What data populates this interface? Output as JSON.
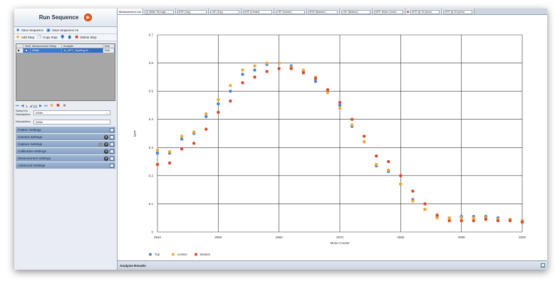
{
  "left_panel": {
    "run_title": "Run Sequence",
    "toolbar1": {
      "save": "Save Sequence",
      "save_as": "Save Sequence As"
    },
    "toolbar2": {
      "add": "Add Step",
      "copy": "Copy Step",
      "delete": "Delete Step"
    },
    "grid": {
      "headers": [
        "Select",
        "Measurement Setup",
        "Analysis",
        "Edit"
      ],
      "row": {
        "measurement": "White",
        "analysis": "3x_MTF_Spatting &l...",
        "edit": "Edit"
      }
    },
    "nav": {
      "page": "1",
      "of": "of {1}"
    },
    "select_for_label": "Select for Description:",
    "select_for_value": "White",
    "description_label": "Description:",
    "description_value": "White",
    "sections": [
      {
        "label": "Pattern Settings",
        "round_icons": []
      },
      {
        "label": "Camera Settings",
        "round_icons": [
          "black"
        ]
      },
      {
        "label": "Capture Settings",
        "round_icons": [
          "gray",
          "black"
        ]
      },
      {
        "label": "Calibration Settings",
        "round_icons": [
          "black"
        ]
      },
      {
        "label": "Measurement Settings",
        "round_icons": [
          "black"
        ]
      },
      {
        "label": "Advanced Settings",
        "round_icons": []
      }
    ]
  },
  "tabs": {
    "first": "Measurement List",
    "items": [
      {
        "label": "",
        "box": "0) White Through ..."
      },
      {
        "label": "",
        "box": "ESF (Top)"
      },
      {
        "label": "",
        "box": "LSF (Top)"
      },
      {
        "label": "",
        "box": "ESF (Center)"
      },
      {
        "label": "",
        "box": "LSF (Center)"
      },
      {
        "label": "",
        "box": "ESF (Bottom)"
      },
      {
        "label": "",
        "box": "LSF (Bottom)"
      },
      {
        "label": "",
        "box": "MTF, Motor Count..."
      },
      {
        "label": "",
        "box": "MTF @ 10 lp/mm"
      },
      {
        "label": "",
        "box": "MTF @ 20 lp/mm"
      }
    ]
  },
  "analysis_results": "Analysis Results",
  "chart_data": {
    "type": "scatter",
    "xlabel": "Motor Counts",
    "ylabel": "MTF",
    "xlim": [
      2940,
      3000
    ],
    "ylim": [
      0,
      0.7
    ],
    "x_ticks": [
      2940,
      2950,
      2960,
      2970,
      2980,
      2990,
      3000
    ],
    "y_ticks": [
      0,
      0.1,
      0.2,
      0.3,
      0.4,
      0.5,
      0.6,
      0.7
    ],
    "grid": true,
    "legend_position": "bottom-left",
    "series": [
      {
        "name": "Top",
        "color": "#4a7fd6",
        "x": [
          2940,
          2942,
          2944,
          2946,
          2948,
          2950,
          2952,
          2954,
          2956,
          2958,
          2960,
          2962,
          2964,
          2966,
          2968,
          2970,
          2972,
          2974,
          2976,
          2978,
          2980,
          2982,
          2984,
          2986,
          2988,
          2990,
          2992,
          2994,
          2996,
          2998,
          3000
        ],
        "y": [
          0.28,
          0.28,
          0.33,
          0.35,
          0.41,
          0.455,
          0.5,
          0.56,
          0.575,
          0.595,
          0.6,
          0.59,
          0.57,
          0.535,
          0.5,
          0.45,
          0.375,
          0.32,
          0.235,
          0.215,
          0.17,
          0.115,
          0.08,
          0.055,
          0.05,
          0.055,
          0.055,
          0.055,
          0.05,
          0.045,
          0.04
        ]
      },
      {
        "name": "Center",
        "color": "#f0a830",
        "x": [
          2940,
          2942,
          2944,
          2946,
          2948,
          2950,
          2952,
          2954,
          2956,
          2958,
          2960,
          2962,
          2964,
          2966,
          2968,
          2970,
          2972,
          2974,
          2976,
          2978,
          2980,
          2982,
          2984,
          2986,
          2988,
          2990,
          2992,
          2994,
          2996,
          2998,
          3000
        ],
        "y": [
          0.29,
          0.285,
          0.34,
          0.355,
          0.42,
          0.47,
          0.52,
          0.575,
          0.59,
          0.6,
          0.6,
          0.585,
          0.575,
          0.55,
          0.495,
          0.44,
          0.38,
          0.32,
          0.24,
          0.22,
          0.17,
          0.11,
          0.08,
          0.05,
          0.05,
          0.05,
          0.05,
          0.05,
          0.045,
          0.045,
          0.04
        ]
      },
      {
        "name": "Bottom",
        "color": "#d64a2a",
        "x": [
          2940,
          2942,
          2944,
          2946,
          2948,
          2950,
          2952,
          2954,
          2956,
          2958,
          2960,
          2962,
          2964,
          2966,
          2968,
          2970,
          2972,
          2974,
          2976,
          2978,
          2980,
          2982,
          2984,
          2986,
          2988,
          2990,
          2992,
          2994,
          2996,
          2998,
          3000
        ],
        "y": [
          0.24,
          0.245,
          0.295,
          0.315,
          0.365,
          0.425,
          0.465,
          0.53,
          0.55,
          0.57,
          0.58,
          0.58,
          0.565,
          0.545,
          0.505,
          0.46,
          0.4,
          0.34,
          0.27,
          0.25,
          0.2,
          0.145,
          0.1,
          0.06,
          0.04,
          0.04,
          0.04,
          0.045,
          0.04,
          0.04,
          0.035
        ]
      }
    ]
  }
}
